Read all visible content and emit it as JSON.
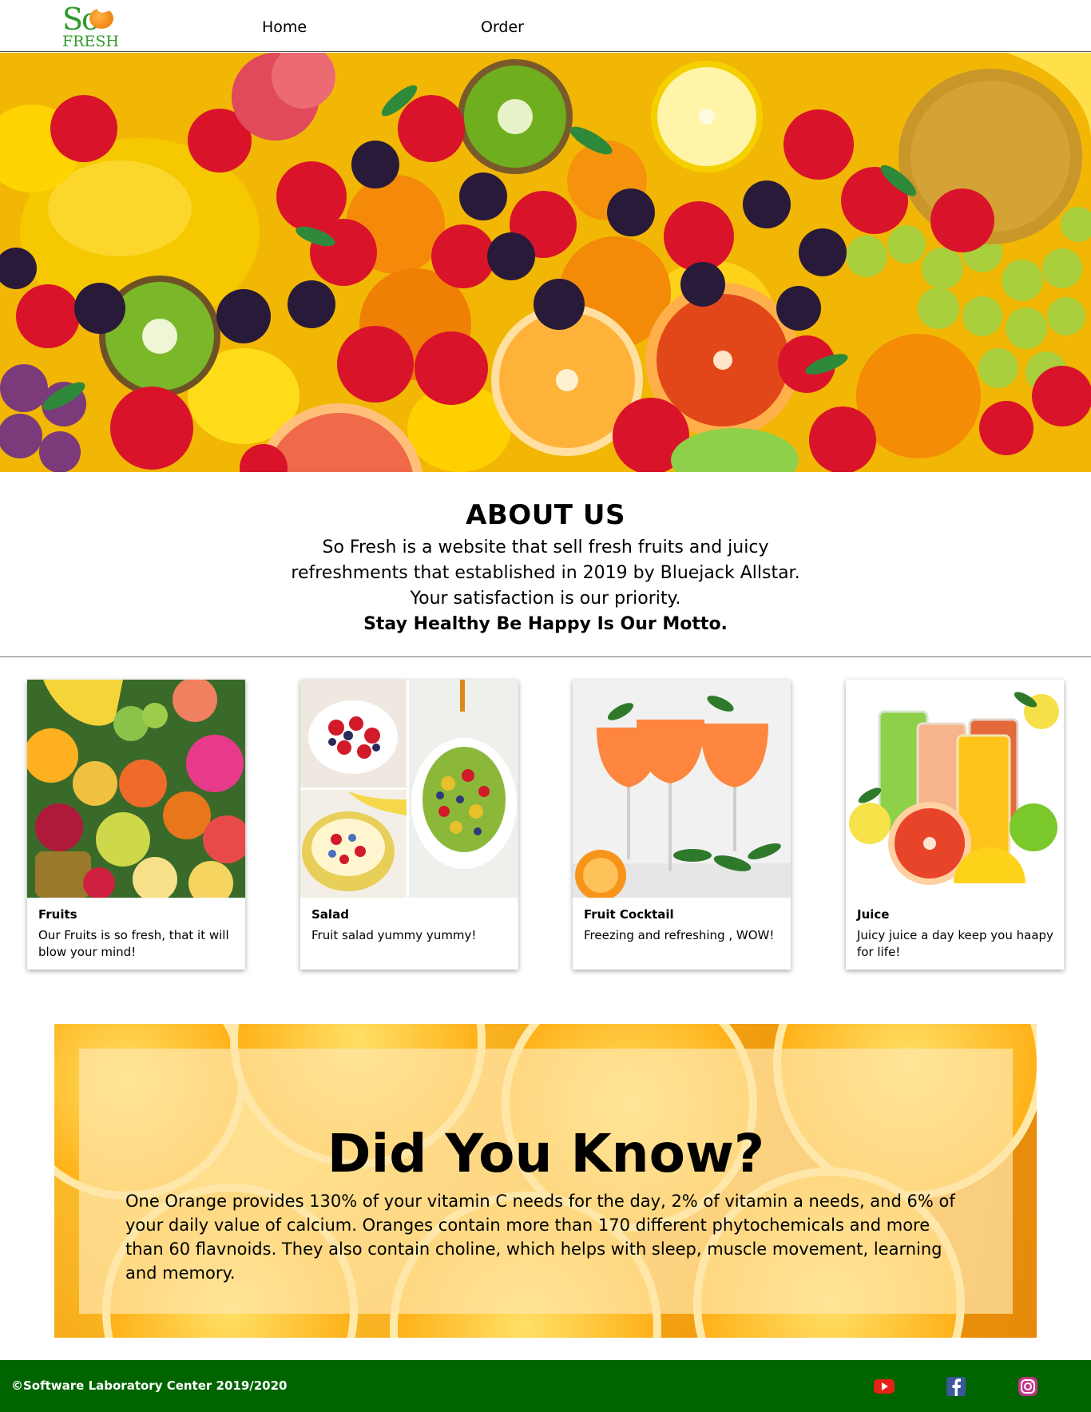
{
  "nav": {
    "logo_top": "So",
    "logo_bottom": "FRESH",
    "links": [
      "Home",
      "Order"
    ]
  },
  "hero": {
    "image": "fresh-fruits-banner"
  },
  "about": {
    "title": "ABOUT US",
    "line1": "So Fresh is a website that sell fresh fruits and juicy",
    "line2": "refreshments that established in 2019 by Bluejack Allstar.",
    "line3": "Your satisfaction is our priority.",
    "motto": "Stay Healthy Be Happy Is Our Motto."
  },
  "cards": [
    {
      "title": "Fruits",
      "desc": "Our Fruits is so fresh, that it will blow your mind!"
    },
    {
      "title": "Salad",
      "desc": "Fruit salad yummy yummy!"
    },
    {
      "title": "Fruit Cocktail",
      "desc": "Freezing and refreshing , WOW!"
    },
    {
      "title": "Juice",
      "desc": "Juicy juice a day keep you haapy for life!"
    }
  ],
  "did_you_know": {
    "title": "Did You Know?",
    "text": "One Orange provides 130% of your vitamin C needs for the day, 2% of vitamin a needs, and 6% of your daily value of calcium. Oranges contain more than 170 different phytochemicals and more than 60 flavnoids. They also contain choline, which helps with sleep, muscle movement, learning and memory."
  },
  "footer": {
    "copyright": "©Software Laboratory Center 2019/2020",
    "social": [
      "youtube-icon",
      "facebook-icon",
      "instagram-icon"
    ]
  },
  "colors": {
    "brand_green": "#2f9a2a",
    "footer_green": "#006400",
    "orange_accent": "#f28c1a"
  }
}
